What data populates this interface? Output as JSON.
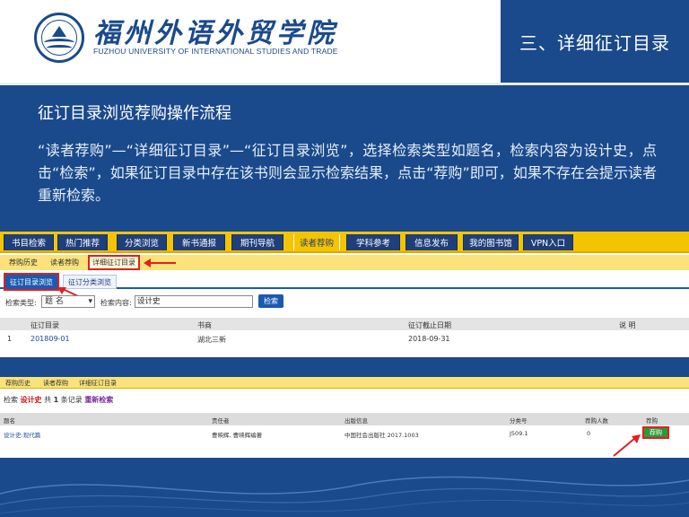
{
  "header": {
    "logo_name": "福州外语外贸学院",
    "logo_english": "FUZHOU UNIVERSITY OF INTERNATIONAL STUDIES AND TRADE",
    "section_title": "三、详细征订目录"
  },
  "instructions": {
    "title": "征订目录浏览荐购操作流程",
    "body": "“读者荐购”—“详细征订目录”—“征订目录浏览”，选择检索类型如题名，检索内容为设计史，点击“检索”，如果征订目录中存在该书则会显示检索结果，点击“荐购”即可，如果不存在会提示读者重新检索。"
  },
  "nav": {
    "items": [
      "书目检索",
      "热门推荐",
      "分类浏览",
      "新书通报",
      "期刊导航",
      "读者荐购",
      "学科参考",
      "信息发布",
      "我的图书馆",
      "VPN入口"
    ],
    "active_index": 5
  },
  "subnav": {
    "items": [
      "荐购历史",
      "读者荐购",
      "详细征订目录"
    ],
    "active_index": 2
  },
  "tabs": {
    "items": [
      "征订目录浏览",
      "征订分类浏览"
    ],
    "active_index": 0
  },
  "search": {
    "type_label": "检索类型:",
    "type_value": "题 名",
    "content_label": "检索内容:",
    "content_value": "设计史",
    "button": "检索"
  },
  "catalog_table": {
    "headers": [
      "征订目录",
      "书商",
      "征订截止日期",
      "说 明"
    ],
    "rows": [
      {
        "index": "1",
        "catalog": "201809-01",
        "vendor": "湖北三新",
        "deadline": "2018-09-31",
        "note": ""
      }
    ]
  },
  "results": {
    "nav_items": [
      "荐购历史",
      "读者荐购",
      "详细征订目录"
    ],
    "label_search": "检索",
    "keyword": "设计史",
    "count_text_pre": "共",
    "count": "1",
    "count_text_post": "条记录",
    "retry": "重新检索",
    "headers": [
      "题名",
      "责任者",
      "出版信息",
      "分类号",
      "荐购人数",
      "荐购"
    ],
    "rows": [
      {
        "title": "设计史:现代篇",
        "author": "曹映辉, 曹映辉编著",
        "publisher": "中国社会出版社 2017.1003",
        "class_no": "J509.1",
        "count": "0",
        "action": "荐购"
      }
    ]
  },
  "colors": {
    "brand_blue": "#1a4a8c",
    "nav_yellow": "#f5c400",
    "highlight_red": "#e02020",
    "button_green": "#2a9a3a"
  }
}
